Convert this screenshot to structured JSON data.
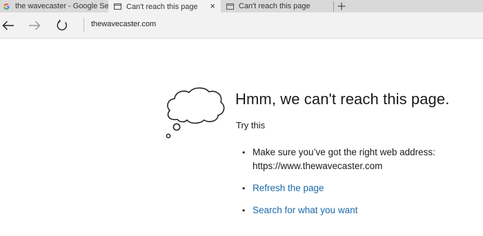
{
  "tabs": [
    {
      "title": "the wavecaster - Google Se",
      "icon": "google-g-icon",
      "active": false
    },
    {
      "title": "Can't reach this page",
      "icon": "page-icon",
      "active": true
    },
    {
      "title": "Can't reach this page",
      "icon": "page-icon",
      "active": false
    }
  ],
  "tab_close_symbol": "×",
  "navbar": {
    "address": "thewavecaster.com"
  },
  "page": {
    "title": "Hmm, we can't reach this page.",
    "try_this": "Try this",
    "suggestions": {
      "check_address_line1": "Make sure you’ve got the right web address:",
      "check_address_line2": "https://www.thewavecaster.com",
      "refresh": "Refresh the page",
      "search": "Search for what you want"
    },
    "bullet": "•"
  },
  "colors": {
    "tabstrip": "#d9d9d9",
    "active_tab": "#f2f2f2",
    "link": "#1a69a8",
    "text": "#1a1a1a"
  }
}
